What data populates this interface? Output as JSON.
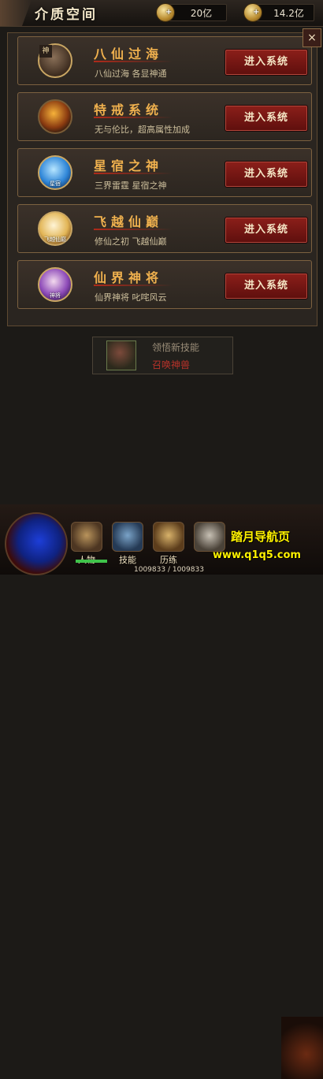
{
  "header": {
    "title": "介质空间",
    "currency1": {
      "value": "20亿",
      "icon": "gold-ingot-icon"
    },
    "currency2": {
      "value": "14.2亿",
      "icon": "gold-ingot-icon"
    }
  },
  "close_label": "×",
  "systems": [
    {
      "avatar_tag": "神",
      "avatar_icon": "immortal-avatar-icon",
      "name": "八仙过海",
      "desc": "八仙过海 各显神通",
      "button": "进入系统"
    },
    {
      "avatar_tag": "",
      "avatar_icon": "flame-ring-icon",
      "name": "特戒系统",
      "desc": "无与伦比，超高属性加成",
      "button": "进入系统"
    },
    {
      "avatar_tag": "星宿",
      "avatar_icon": "star-constellation-icon",
      "name": "星宿之神",
      "desc": "三界雷霆 星宿之神",
      "button": "进入系统"
    },
    {
      "avatar_tag": "飞越仙巅",
      "avatar_icon": "winged-immortal-icon",
      "name": "飞越仙巅",
      "desc": "修仙之初 飞越仙巅",
      "button": "进入系统"
    },
    {
      "avatar_tag": "神将",
      "avatar_icon": "divine-general-icon",
      "name": "仙界神将",
      "desc": "仙界神将 叱咤风云",
      "button": "进入系统"
    }
  ],
  "skill_panel": {
    "learn": "领悟新技能",
    "summon": "召唤神兽"
  },
  "bottom_nav": [
    {
      "label": "人物",
      "icon": "character-icon"
    },
    {
      "label": "技能",
      "icon": "skill-book-icon"
    },
    {
      "label": "历练",
      "icon": "training-icon"
    },
    {
      "label": "",
      "icon": "equipment-icon"
    }
  ],
  "hp_text": "1009833 / 1009833",
  "watermark": {
    "line1": "踏月导航页",
    "line2": "www.q1q5.com"
  }
}
